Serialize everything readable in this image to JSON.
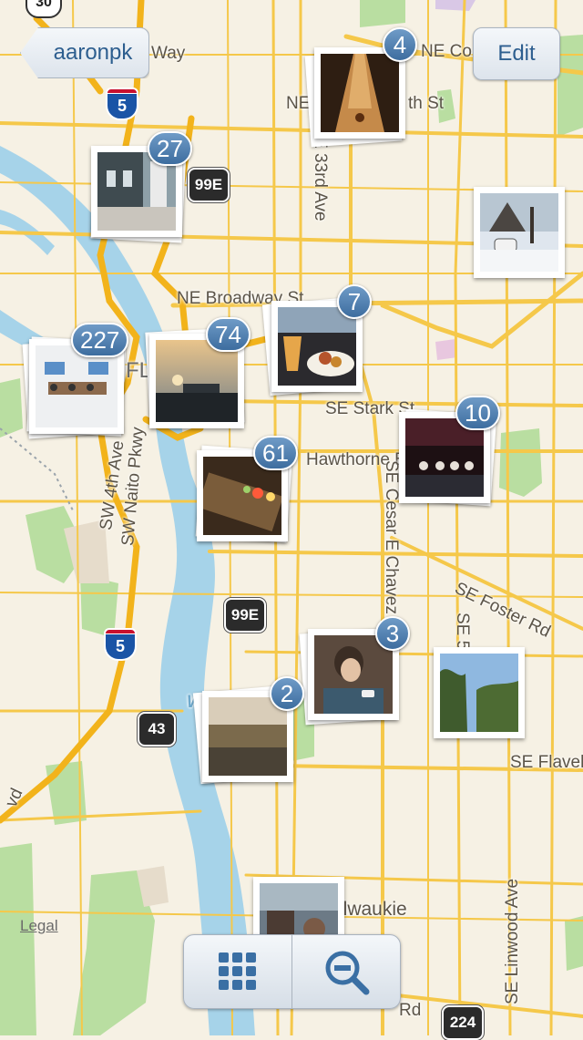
{
  "nav": {
    "back_label": "aaronpk",
    "edit_label": "Edit"
  },
  "map": {
    "labels": [
      {
        "id": "way",
        "text": "Way"
      },
      {
        "id": "ne-c",
        "text": "NE Co"
      },
      {
        "id": "ne-th",
        "text": "NE"
      },
      {
        "id": "ne-th2",
        "text": "th St"
      },
      {
        "id": "e33",
        "text": "E 33rd Ave"
      },
      {
        "id": "broadway",
        "text": "NE Broadway St"
      },
      {
        "id": "stark",
        "text": "SE Stark St"
      },
      {
        "id": "hawthorne",
        "text": "Hawthorne Blvd"
      },
      {
        "id": "cesar",
        "text": "SE Cesar E Chavez Blvd"
      },
      {
        "id": "foster",
        "text": "SE Foster Rd"
      },
      {
        "id": "se50",
        "text": "SE 50th"
      },
      {
        "id": "flavel",
        "text": "SE Flavel"
      },
      {
        "id": "linwood",
        "text": "SE Linwood Ave"
      },
      {
        "id": "milwaukie",
        "text": "ilwaukie"
      },
      {
        "id": "sw4",
        "text": "SW 4th Ave"
      },
      {
        "id": "naito",
        "text": "SW Naito Pkwy"
      },
      {
        "id": "fl",
        "text": "FL"
      },
      {
        "id": "w",
        "text": "W"
      },
      {
        "id": "vd",
        "text": "vd"
      },
      {
        "id": "rd",
        "text": "Rd"
      }
    ],
    "shields": [
      {
        "id": "i5-top",
        "text": "5"
      },
      {
        "id": "i5-bottom",
        "text": "5"
      },
      {
        "id": "r99e-top",
        "text": "99E"
      },
      {
        "id": "r99e-bottom",
        "text": "99E"
      },
      {
        "id": "r43",
        "text": "43"
      },
      {
        "id": "r224",
        "text": "224"
      },
      {
        "id": "r30",
        "text": "30"
      }
    ],
    "legal": "Legal"
  },
  "clusters": [
    {
      "id": "c1",
      "count": "4",
      "scene": "bowling-alley"
    },
    {
      "id": "c2",
      "count": "27",
      "scene": "synths-sign"
    },
    {
      "id": "c3",
      "count": null,
      "scene": "snowy-car"
    },
    {
      "id": "c4",
      "count": "7",
      "scene": "beer-food"
    },
    {
      "id": "c5",
      "count": "227",
      "scene": "conference-room"
    },
    {
      "id": "c6",
      "count": "74",
      "scene": "sunset-harbor"
    },
    {
      "id": "c7",
      "count": "10",
      "scene": "panel-stage"
    },
    {
      "id": "c8",
      "count": "61",
      "scene": "synth-lights"
    },
    {
      "id": "c9",
      "count": "3",
      "scene": "person-phone"
    },
    {
      "id": "c10",
      "count": null,
      "scene": "trees-sky"
    },
    {
      "id": "c11",
      "count": "2",
      "scene": "field-landscape"
    },
    {
      "id": "c12",
      "count": null,
      "scene": "street-people"
    }
  ],
  "toolbar": {
    "grid_icon": "grid-icon",
    "zoom_icon": "zoom-out-icon"
  },
  "colors": {
    "badge": "#4f7fb2",
    "water": "#a6d3e9",
    "park": "#b9dea1",
    "road": "#f5c84a",
    "land": "#f6f1e4"
  }
}
